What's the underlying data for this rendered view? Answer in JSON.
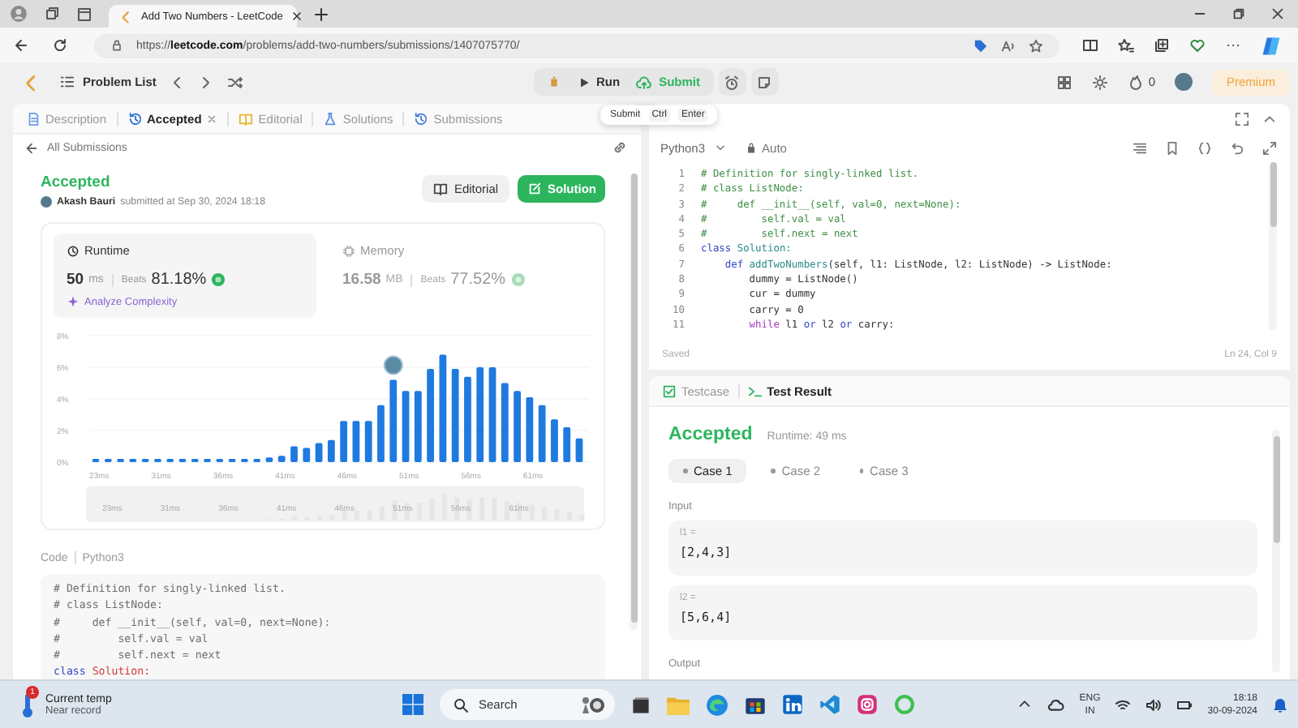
{
  "browser": {
    "tab_title": "Add Two Numbers - LeetCode",
    "url": "https://**leetcode.com**/problems/add-two-numbers/submissions/1407075770/"
  },
  "navbar": {
    "problem_list": "Problem List",
    "run": "Run",
    "submit": "Submit",
    "streak": "0",
    "premium": "Premium"
  },
  "tooltip": {
    "label": "Submit",
    "keys": [
      "Ctrl",
      "Enter"
    ]
  },
  "left_tabs": [
    {
      "label": "Description",
      "selected": false,
      "closable": false,
      "kind": "description"
    },
    {
      "label": "Accepted",
      "selected": true,
      "closable": true,
      "kind": "history"
    },
    {
      "label": "Editorial",
      "selected": false,
      "closable": false,
      "kind": "editorial"
    },
    {
      "label": "Solutions",
      "selected": false,
      "closable": false,
      "kind": "solutions"
    },
    {
      "label": "Submissions",
      "selected": false,
      "closable": false,
      "kind": "history"
    }
  ],
  "back_link": "All Submissions",
  "submission": {
    "status": "Accepted",
    "user": "Akash Bauri",
    "submitted": "submitted at Sep 30, 2024 18:18",
    "buttons": [
      {
        "label": "Editorial",
        "kind": "secondary"
      },
      {
        "label": "Solution",
        "kind": "primary"
      }
    ]
  },
  "metrics": [
    {
      "label": "Runtime",
      "kind": "runtime",
      "value": "50",
      "unit": "ms",
      "beats_label": "Beats",
      "beats": "81.18%",
      "selected": true
    },
    {
      "label": "Memory",
      "kind": "memory",
      "value": "16.58",
      "unit": "MB",
      "beats_label": "Beats",
      "beats": "77.52%",
      "selected": false
    }
  ],
  "analyze": "Analyze Complexity",
  "chart_data": {
    "type": "bar",
    "categories": [
      "23ms",
      null,
      null,
      null,
      null,
      "31ms",
      null,
      null,
      null,
      null,
      "36ms",
      null,
      null,
      null,
      null,
      "41ms",
      null,
      null,
      null,
      null,
      "46ms",
      null,
      null,
      null,
      null,
      "51ms",
      null,
      null,
      null,
      null,
      "56ms",
      null,
      null,
      null,
      null,
      "61ms",
      null,
      null,
      null,
      null
    ],
    "values": [
      0.2,
      0.2,
      0.2,
      0.2,
      0.2,
      0.2,
      0.2,
      0.2,
      0.2,
      0.2,
      0.2,
      0.2,
      0.2,
      0.2,
      0.3,
      0.4,
      1.0,
      0.9,
      1.2,
      1.4,
      2.6,
      2.6,
      2.6,
      3.6,
      5.2,
      4.5,
      4.5,
      5.9,
      6.8,
      5.9,
      5.4,
      6.0,
      6.0,
      5.0,
      4.5,
      4.1,
      3.6,
      2.7,
      2.2,
      1.5
    ],
    "ylim": [
      0,
      8
    ],
    "yticks": [
      {
        "value": 0,
        "label": "0%"
      },
      {
        "value": 2,
        "label": "2%"
      },
      {
        "value": 4,
        "label": "4%"
      },
      {
        "value": 6,
        "label": "6%"
      },
      {
        "value": 8,
        "label": "8%"
      }
    ],
    "grid": true
  },
  "range": {
    "level": 1,
    "labels": [
      "23ms",
      "31ms",
      "36ms",
      "41ms",
      "46ms",
      "51ms",
      "56ms",
      "61ms"
    ]
  },
  "code_view": {
    "label": "Code",
    "language": "Python3",
    "lines": [
      [
        {
          "text": "# Definition for singly-linked list.",
          "kind": "c"
        }
      ],
      [
        {
          "text": "# class ListNode:",
          "kind": "c"
        }
      ],
      [
        {
          "text": "#     def __init__(self, val=0, next=None):",
          "kind": "c"
        }
      ],
      [
        {
          "text": "#         self.val = val",
          "kind": "c"
        }
      ],
      [
        {
          "text": "#         self.next = next",
          "kind": "c"
        }
      ],
      [
        {
          "text": "class",
          "kind": "k"
        },
        {
          "text": " Solution:",
          "kind": "r"
        }
      ]
    ]
  },
  "editor": {
    "language": "Python3",
    "mode": "Auto",
    "status": "Saved",
    "cursor": "Ln 24, Col 9",
    "lines": [
      {
        "number": "1",
        "tokens": [
          {
            "text": "# Definition for singly-linked list.",
            "kind": "c"
          }
        ]
      },
      {
        "number": "2",
        "tokens": [
          {
            "text": "# class ListNode:",
            "kind": "c"
          }
        ]
      },
      {
        "number": "3",
        "tokens": [
          {
            "text": "#     def __init__(self, val=0, next=None):",
            "kind": "c"
          }
        ]
      },
      {
        "number": "4",
        "tokens": [
          {
            "text": "#         self.val = val",
            "kind": "c"
          }
        ]
      },
      {
        "number": "5",
        "tokens": [
          {
            "text": "#         self.next = next",
            "kind": "c"
          }
        ]
      },
      {
        "number": "6",
        "tokens": [
          {
            "text": "class",
            "kind": "k"
          },
          {
            "text": " Solution:",
            "kind": "f"
          }
        ]
      },
      {
        "number": "7",
        "tokens": [
          {
            "text": "    def",
            "kind": "k"
          },
          {
            "text": " addTwoNumbers",
            "kind": "f"
          },
          {
            "text": "(self, l1: ListNode, l2: ListNode) -> ListNode:",
            "kind": "p"
          }
        ]
      },
      {
        "number": "8",
        "tokens": [
          {
            "text": "        dummy = ListNode()",
            "kind": "p"
          }
        ]
      },
      {
        "number": "9",
        "tokens": [
          {
            "text": "        cur = dummy",
            "kind": "p"
          }
        ]
      },
      {
        "number": "10",
        "tokens": [
          {
            "text": "        carry = 0",
            "kind": "p"
          }
        ]
      },
      {
        "number": "11",
        "tokens": [
          {
            "text": "        while",
            "kind": "w"
          },
          {
            "text": " l1 ",
            "kind": "p"
          },
          {
            "text": "or",
            "kind": "k"
          },
          {
            "text": " l2 ",
            "kind": "p"
          },
          {
            "text": "or",
            "kind": "k"
          },
          {
            "text": " carry:",
            "kind": "p"
          }
        ]
      }
    ]
  },
  "result_tabs": [
    {
      "label": "Testcase",
      "selected": false,
      "kind": "testcase"
    },
    {
      "label": "Test Result",
      "selected": true,
      "kind": "terminal"
    }
  ],
  "result": {
    "status": "Accepted",
    "runtime": "Runtime: 49 ms",
    "cases": [
      {
        "label": "Case 1",
        "selected": true
      },
      {
        "label": "Case 2",
        "selected": false
      },
      {
        "label": "Case 3",
        "selected": false
      }
    ],
    "input_label": "Input",
    "inputs": [
      {
        "name": "l1 =",
        "value": "[2,4,3]"
      },
      {
        "name": "l2 =",
        "value": "[5,6,4]"
      }
    ],
    "output_label": "Output"
  },
  "taskbar": {
    "weather_title": "Current temp",
    "weather_sub": "Near record",
    "weather_badge": "1",
    "search": "Search",
    "lang": "ENG",
    "region": "IN",
    "time": "18:18",
    "date": "30-09-2024"
  }
}
